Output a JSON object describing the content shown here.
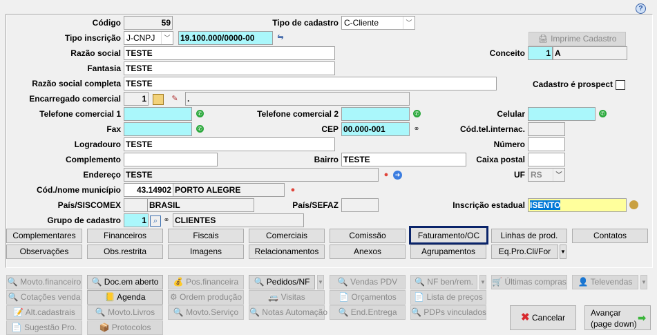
{
  "form": {
    "codigo": {
      "label": "Código",
      "value": "59"
    },
    "tipo_cadastro": {
      "label": "Tipo de cadastro",
      "value": "C-Cliente"
    },
    "tipo_inscricao": {
      "label": "Tipo inscrição",
      "value": "J-CNPJ",
      "document": "19.100.000/0000-00"
    },
    "imprime": "Imprime Cadastro",
    "razao_social": {
      "label": "Razão social",
      "value": "TESTE"
    },
    "conceito": {
      "label": "Conceito",
      "code": "1",
      "value": "A"
    },
    "fantasia": {
      "label": "Fantasia",
      "value": "TESTE"
    },
    "razao_completa": {
      "label": "Razão social completa",
      "value": "TESTE"
    },
    "prospect": {
      "label": "Cadastro é prospect",
      "checked": false
    },
    "encarregado": {
      "label": "Encarregado comercial",
      "code": "1",
      "name": "."
    },
    "tel1": {
      "label": "Telefone comercial 1",
      "value": ""
    },
    "tel2": {
      "label": "Telefone comercial 2",
      "value": ""
    },
    "celular": {
      "label": "Celular",
      "value": ""
    },
    "fax": {
      "label": "Fax",
      "value": ""
    },
    "cep": {
      "label": "CEP",
      "value": "00.000-001"
    },
    "codtel": {
      "label": "Cód.tel.internac.",
      "value": ""
    },
    "logradouro": {
      "label": "Logradouro",
      "value": "TESTE"
    },
    "numero": {
      "label": "Número",
      "value": ""
    },
    "complemento": {
      "label": "Complemento",
      "value": ""
    },
    "bairro": {
      "label": "Bairro",
      "value": "TESTE"
    },
    "caixa": {
      "label": "Caixa postal",
      "value": ""
    },
    "endereco": {
      "label": "Endereço",
      "value": "TESTE"
    },
    "uf": {
      "label": "UF",
      "value": "RS"
    },
    "municipio": {
      "label": "Cód./nome município",
      "code": "43.14902",
      "name": "PORTO ALEGRE"
    },
    "pais_siscomex": {
      "label": "País/SISCOMEX",
      "code": "",
      "name": "BRASIL"
    },
    "pais_sefaz": {
      "label": "País/SEFAZ",
      "value": ""
    },
    "ie": {
      "label": "Inscrição estadual",
      "value": "ISENTO"
    },
    "grupo": {
      "label": "Grupo de cadastro",
      "code": "1",
      "name": "CLIENTES"
    }
  },
  "tabs": [
    "Complementares",
    "Financeiros",
    "Fiscais",
    "Comerciais",
    "Comissão",
    "Faturamento/OC",
    "Linhas de prod.",
    "Contatos",
    "Observações",
    "Obs.restrita",
    "Imagens",
    "Relacionamentos",
    "Anexos",
    "Agrupamentos",
    "Eq.Pro.Cli/For"
  ],
  "actions": [
    "Movto.financeiro",
    "Doc.em aberto",
    "Pos.financeira",
    "Pedidos/NF",
    "Vendas PDV",
    "NF ben/rem.",
    "Últimas compras",
    "Televendas",
    "Cotações venda",
    "Agenda",
    "Ordem produção",
    "Visitas",
    "Orçamentos",
    "Lista de preços",
    "Alt.cadastrais",
    "Movto.Livros",
    "Movto.Serviço",
    "Notas Automação",
    "End.Entrega",
    "PDPs vinculados",
    "Sugestão Pro.",
    "Protocolos"
  ],
  "cancel": "Cancelar",
  "next": {
    "line1": "Avançar",
    "line2": "(page down)"
  },
  "colors": {
    "accent": "#0a246a",
    "cyan": "#aaf7fb",
    "yellow": "#ffff9c"
  }
}
